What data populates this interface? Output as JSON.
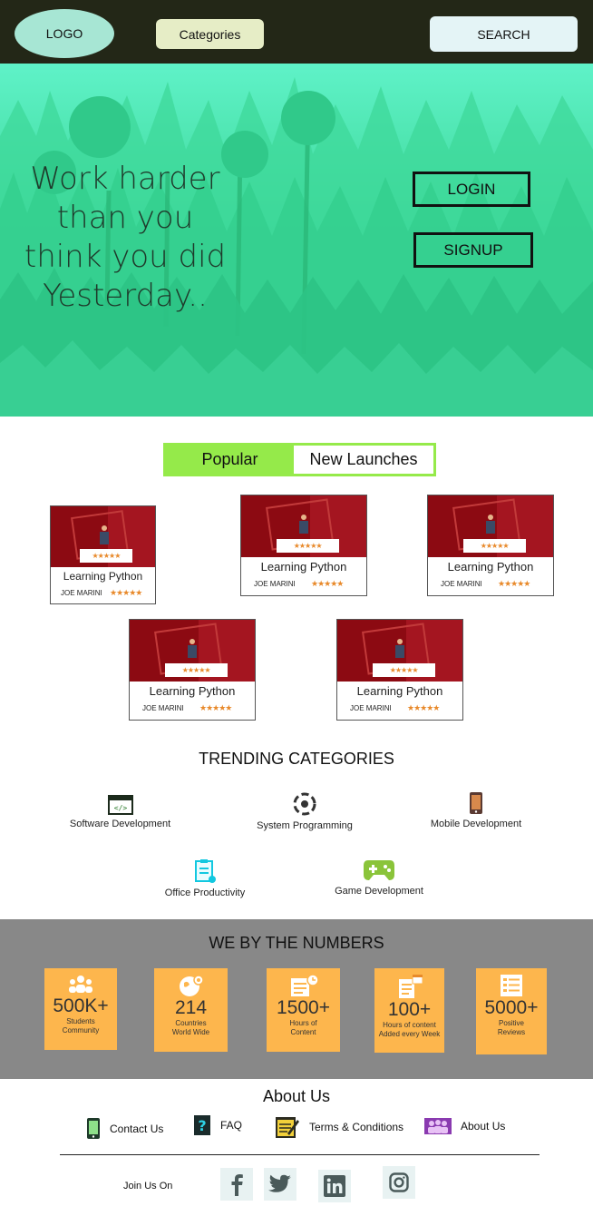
{
  "header": {
    "logo": "LOGO",
    "categories": "Categories",
    "search": "SEARCH"
  },
  "hero": {
    "tagline": [
      "Work harder",
      "than you",
      "think you did",
      "Yesterday.."
    ],
    "login": "LOGIN",
    "signup": "SIGNUP"
  },
  "tabs": {
    "popular": "Popular",
    "new_launches": "New Launches"
  },
  "courses": [
    {
      "title": "Learning Python",
      "author": "JOE MARINI",
      "rating": "★★★★★"
    },
    {
      "title": "Learning Python",
      "author": "JOE MARINI",
      "rating": "★★★★★"
    },
    {
      "title": "Learning Python",
      "author": "JOE MARINI",
      "rating": "★★★★★"
    },
    {
      "title": "Learning Python",
      "author": "JOE MARINI",
      "rating": "★★★★★"
    },
    {
      "title": "Learning Python",
      "author": "JOE MARINI",
      "rating": "★★★★★"
    }
  ],
  "trending": {
    "title": "TRENDING CATEGORIES",
    "items": [
      {
        "label": "Software Development",
        "icon": "code-window-icon"
      },
      {
        "label": "System Programming",
        "icon": "system-gear-icon"
      },
      {
        "label": "Mobile Development",
        "icon": "mobile-phone-icon"
      },
      {
        "label": "Office Productivity",
        "icon": "clipboard-icon"
      },
      {
        "label": "Game Development",
        "icon": "gamepad-icon"
      }
    ]
  },
  "numbers": {
    "title": "WE BY THE NUMBERS",
    "stats": [
      {
        "value": "500K+",
        "label": "Students\nCommunity",
        "icon": "community-icon"
      },
      {
        "value": "214",
        "label": "Countries\nWorld Wide",
        "icon": "globe-pin-icon"
      },
      {
        "value": "1500+",
        "label": "Hours of\nContent",
        "icon": "content-clock-icon"
      },
      {
        "value": "100+",
        "label": "Hours of content\nAdded every Week",
        "icon": "calendar-doc-icon"
      },
      {
        "value": "5000+",
        "label": "Positive\nReviews",
        "icon": "review-list-icon"
      }
    ]
  },
  "footer": {
    "about_title": "About Us",
    "links": [
      {
        "label": "Contact Us",
        "icon": "phone-icon"
      },
      {
        "label": "FAQ",
        "icon": "question-icon"
      },
      {
        "label": "Terms & Conditions",
        "icon": "notepad-pencil-icon"
      },
      {
        "label": "About Us",
        "icon": "team-icon"
      }
    ],
    "join": "Join Us On",
    "social": [
      {
        "glyph": "f",
        "icon": "facebook-icon"
      },
      {
        "glyph": "",
        "icon": "twitter-icon"
      },
      {
        "glyph": "in",
        "icon": "linkedin-icon"
      },
      {
        "glyph": "",
        "icon": "instagram-icon"
      }
    ]
  },
  "colors": {
    "header_bg": "#232717",
    "hero_green": "#2fc982",
    "tab_green": "#95ea4a",
    "numbers_bg": "#888888",
    "stat_orange": "#fdb64d",
    "course_red": "#8c0a12"
  }
}
